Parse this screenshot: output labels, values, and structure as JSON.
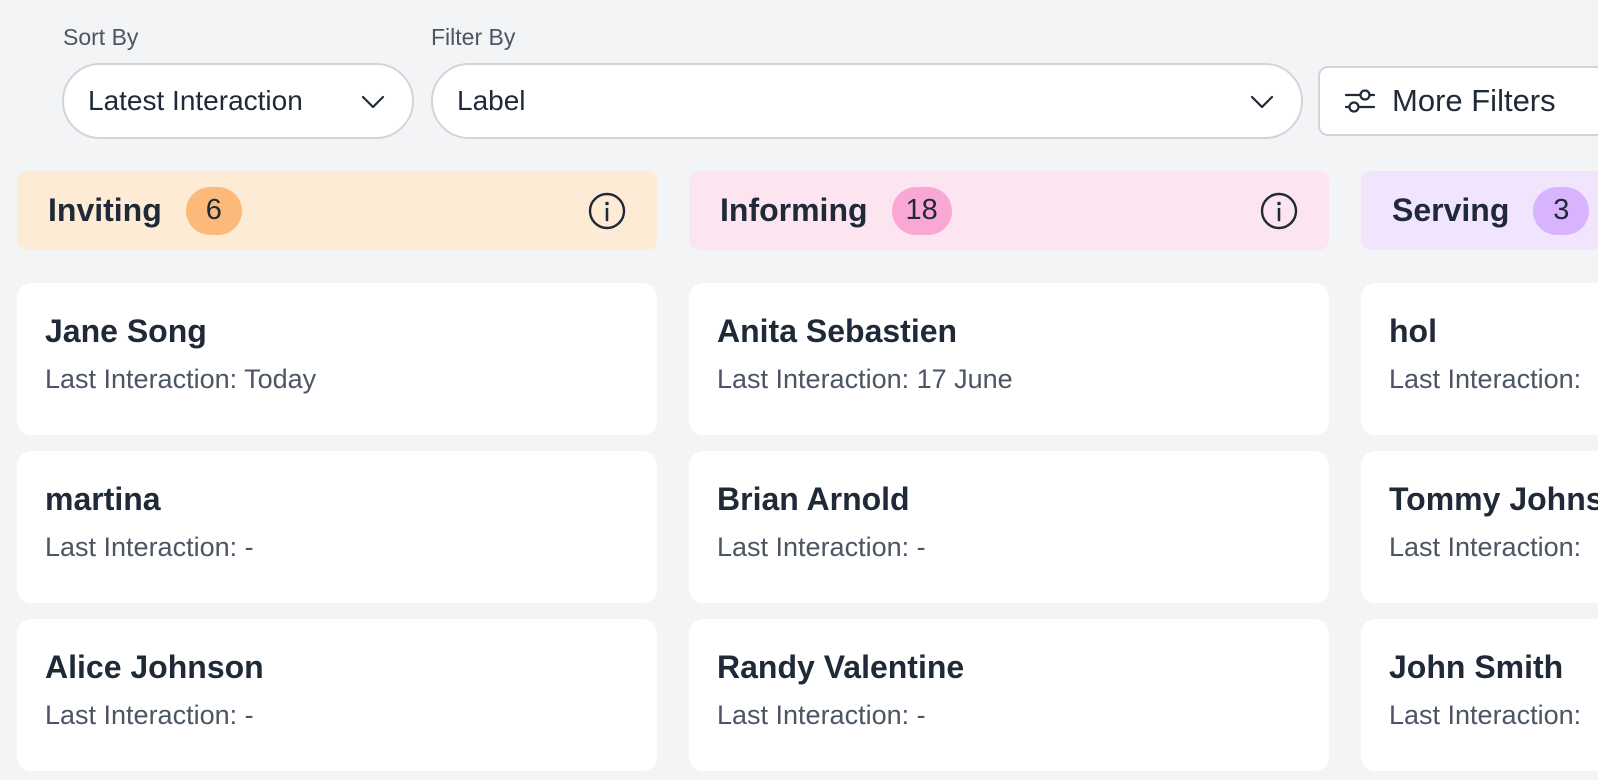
{
  "toolbar": {
    "sort_label": "Sort By",
    "sort_value": "Latest Interaction",
    "filter_label": "Filter By",
    "filter_value": "Label",
    "more_filters_label": "More Filters"
  },
  "icons": {
    "chevron": "chevron-down-icon",
    "filters": "sliders-icon",
    "info": "info-icon"
  },
  "colors": {
    "inviting_header": "#feebd6",
    "inviting_badge": "#fdb97a",
    "informing_header": "#fce4f1",
    "informing_badge": "#f9a8d4",
    "serving_header": "#f1e4fd",
    "serving_badge": "#d8b4fe"
  },
  "columns": [
    {
      "title": "Inviting",
      "count": "6",
      "cards": [
        {
          "name": "Jane Song",
          "meta": "Last Interaction: Today"
        },
        {
          "name": "martina",
          "meta": "Last Interaction: -"
        },
        {
          "name": "Alice Johnson",
          "meta": "Last Interaction: -"
        }
      ]
    },
    {
      "title": "Informing",
      "count": "18",
      "cards": [
        {
          "name": "Anita Sebastien",
          "meta": "Last Interaction: 17 June"
        },
        {
          "name": "Brian Arnold",
          "meta": "Last Interaction: -"
        },
        {
          "name": "Randy Valentine",
          "meta": "Last Interaction: -"
        }
      ]
    },
    {
      "title": "Serving",
      "count": "3",
      "cards": [
        {
          "name": "hol",
          "meta": "Last Interaction:"
        },
        {
          "name": "Tommy Johns",
          "meta": "Last Interaction:"
        },
        {
          "name": "John Smith",
          "meta": "Last Interaction:"
        }
      ]
    }
  ]
}
